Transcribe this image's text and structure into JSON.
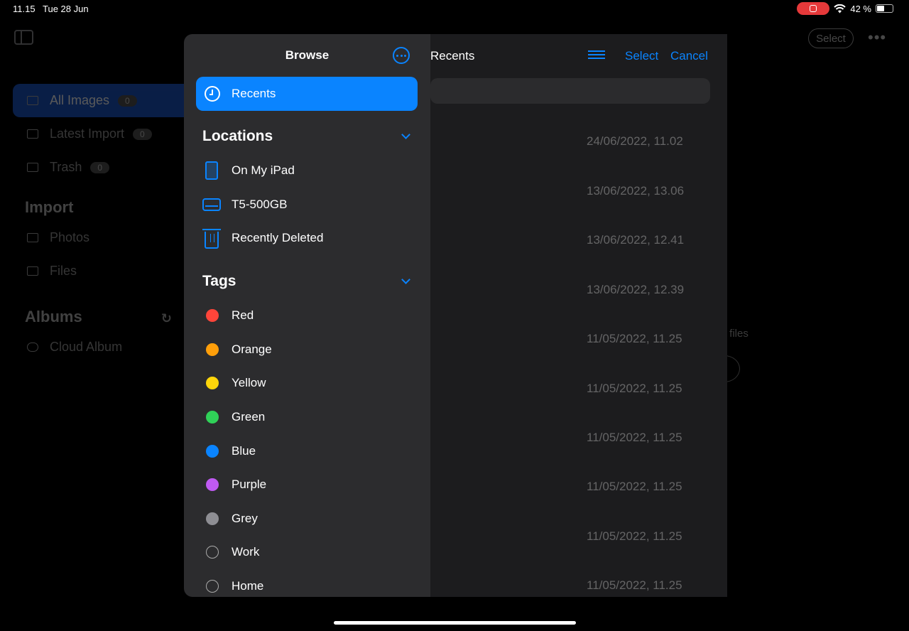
{
  "status_bar": {
    "time": "11.15",
    "date": "Tue 28 Jun",
    "battery": "42 %"
  },
  "background": {
    "select_label": "Select",
    "more_label": "•••",
    "sidebar": {
      "items": [
        {
          "label": "All Images",
          "count": "0",
          "selected": true
        },
        {
          "label": "Latest Import",
          "count": "0",
          "selected": false
        },
        {
          "label": "Trash",
          "count": "0",
          "selected": false
        }
      ],
      "import_title": "Import",
      "import_items": [
        {
          "label": "Photos"
        },
        {
          "label": "Files"
        }
      ],
      "albums_title": "Albums",
      "album_items": [
        {
          "label": "Cloud Album"
        }
      ]
    },
    "files": {
      "title": "Recents",
      "select_label": "Select",
      "cancel_label": "Cancel",
      "dates": [
        "24/06/2022, 11.02",
        "13/06/2022, 13.06",
        "13/06/2022, 12.41",
        "13/06/2022, 12.39",
        "11/05/2022, 11.25",
        "11/05/2022, 11.25",
        "11/05/2022, 11.25",
        "11/05/2022, 11.25",
        "11/05/2022, 11.25",
        "11/05/2022, 11.25"
      ],
      "hint": "r files"
    }
  },
  "browse": {
    "title": "Browse",
    "recents_label": "Recents",
    "locations_title": "Locations",
    "locations": [
      {
        "label": "On My iPad",
        "icon": "ipad-icon"
      },
      {
        "label": "T5-500GB",
        "icon": "drive-icon"
      },
      {
        "label": "Recently Deleted",
        "icon": "trash-icon"
      }
    ],
    "tags_title": "Tags",
    "tags": [
      {
        "label": "Red",
        "color": "#ff453a"
      },
      {
        "label": "Orange",
        "color": "#ff9f0a"
      },
      {
        "label": "Yellow",
        "color": "#ffd60a"
      },
      {
        "label": "Green",
        "color": "#30d158"
      },
      {
        "label": "Blue",
        "color": "#0a84ff"
      },
      {
        "label": "Purple",
        "color": "#bf5af2"
      },
      {
        "label": "Grey",
        "color": "#8e8e93"
      },
      {
        "label": "Work",
        "color": ""
      },
      {
        "label": "Home",
        "color": ""
      }
    ]
  }
}
